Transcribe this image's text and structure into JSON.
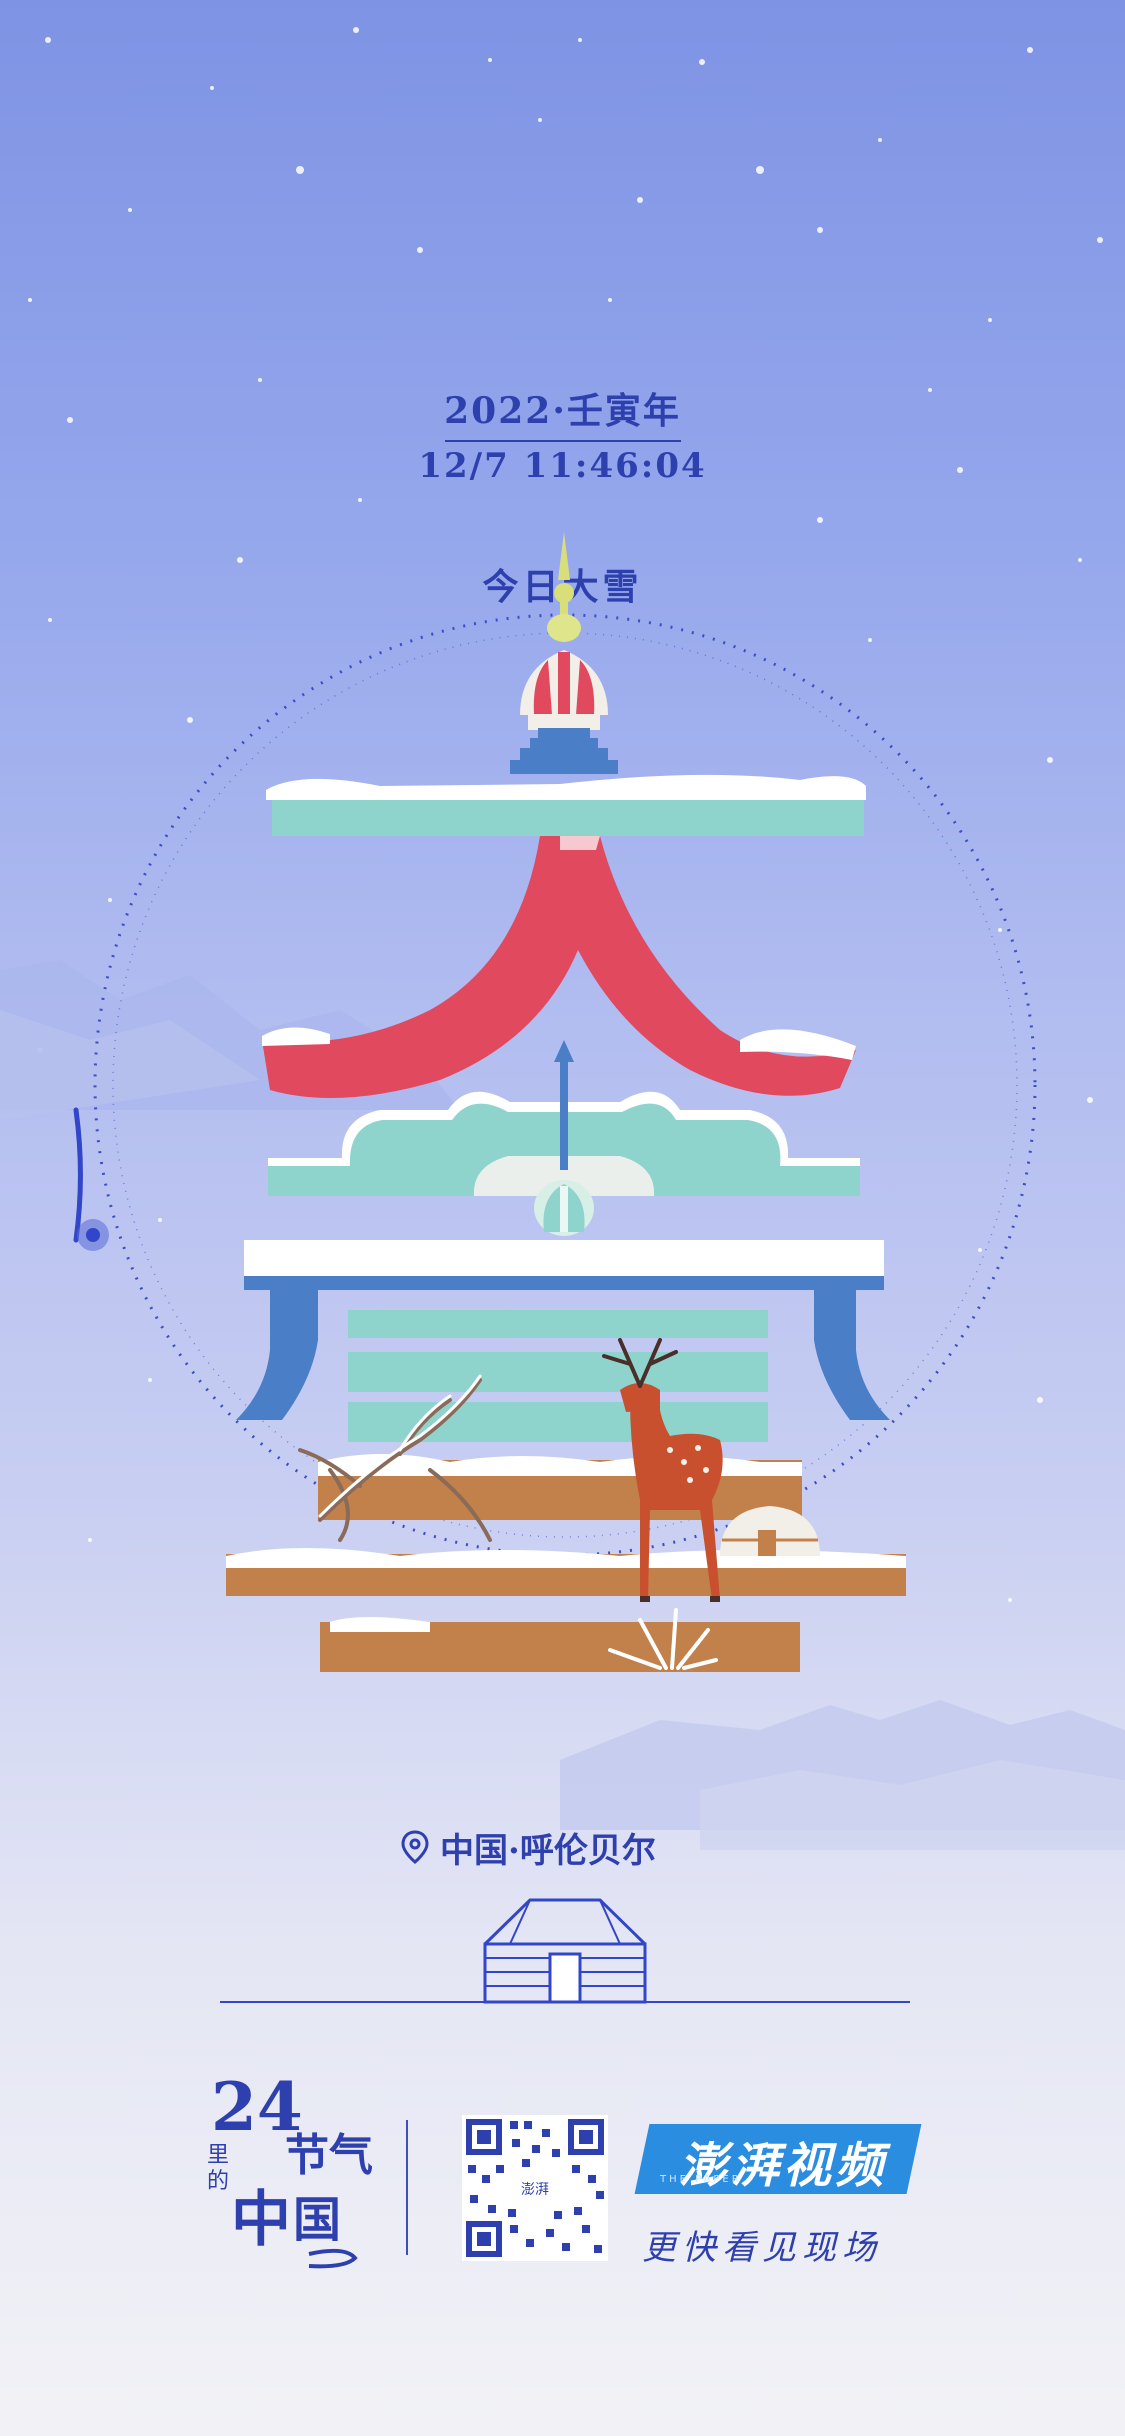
{
  "header": {
    "year_label": "2022·壬寅年",
    "datetime": "12/7 11:46:04",
    "today_label": "今日大雪"
  },
  "location": {
    "label": "中国·呼伦贝尔",
    "icon": "location-pin-icon"
  },
  "footer": {
    "logo_number": "24",
    "logo_chars": [
      "节",
      "气",
      "里",
      "的",
      "中",
      "国"
    ],
    "brand_name": "澎湃视频",
    "brand_subtext": "THE PAPER",
    "qr_center_text": "澎湃",
    "slogan": "更快看见现场"
  },
  "colors": {
    "accent": "#2e3fae",
    "brand_blue": "#2a8de0",
    "red": "#e0495e",
    "teal": "#8fd4cc",
    "blue": "#4a7fc8",
    "brown": "#c2804a"
  }
}
